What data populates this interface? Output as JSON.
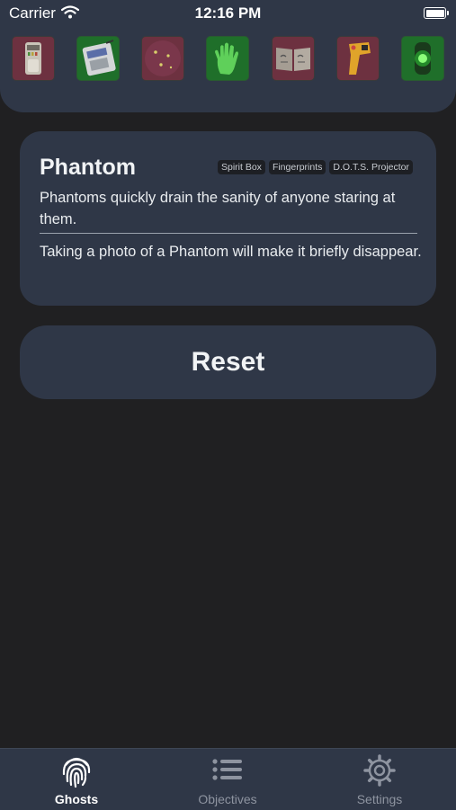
{
  "status_bar": {
    "carrier": "Carrier",
    "time": "12:16 PM"
  },
  "evidence": [
    {
      "name": "emf-reader",
      "state": "off"
    },
    {
      "name": "spirit-box",
      "state": "on"
    },
    {
      "name": "ghost-orbs",
      "state": "off"
    },
    {
      "name": "fingerprints",
      "state": "on"
    },
    {
      "name": "ghost-writing",
      "state": "off"
    },
    {
      "name": "freezing-temperatures",
      "state": "off"
    },
    {
      "name": "dots-projector",
      "state": "on"
    }
  ],
  "ghost_card": {
    "name": "Phantom",
    "tags": [
      "Spirit Box",
      "Fingerprints",
      "D.O.T.S. Projector"
    ],
    "description": "Phantoms quickly drain the sanity of anyone staring at them.",
    "tip": "Taking a photo of a Phantom will make it briefly disappear."
  },
  "reset_label": "Reset",
  "tabs": [
    {
      "label": "Ghosts",
      "icon": "fingerprint-icon",
      "active": true
    },
    {
      "label": "Objectives",
      "icon": "list-icon",
      "active": false
    },
    {
      "label": "Settings",
      "icon": "gear-icon",
      "active": false
    }
  ],
  "colors": {
    "background": "#202022",
    "panel": "#2f3747",
    "evidence_off": "#6d3140",
    "evidence_on": "#1f6f2a"
  }
}
